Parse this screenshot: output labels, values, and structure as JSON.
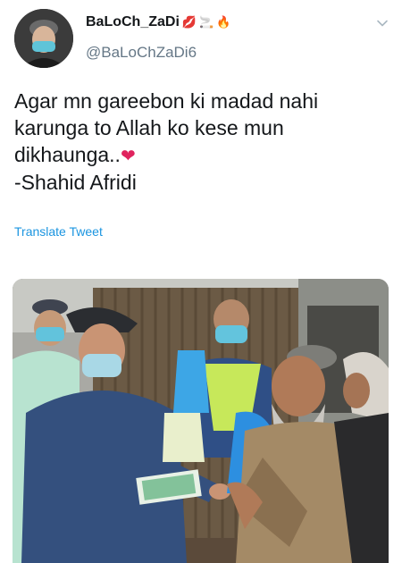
{
  "author": {
    "display_name": "BaLoCh_ZaDi",
    "name_emojis": [
      "💋",
      "🚬",
      "🔥"
    ],
    "handle": "@BaLoChZaDi6"
  },
  "tweet": {
    "lines": [
      "Agar mn gareebon ki madad nahi",
      "karunga to Allah ko kese mun",
      "dikhaunga..",
      "-Shahid Afridi"
    ],
    "heart_emoji": "❤",
    "translate_label": "Translate Tweet"
  },
  "icons": {
    "menu": "chevron-down-icon",
    "avatar": "avatar-image",
    "media": "tweet-photo"
  },
  "colors": {
    "link": "#1b95e0",
    "handle": "#657786",
    "text": "#14171a",
    "heart": "#e0245e"
  }
}
